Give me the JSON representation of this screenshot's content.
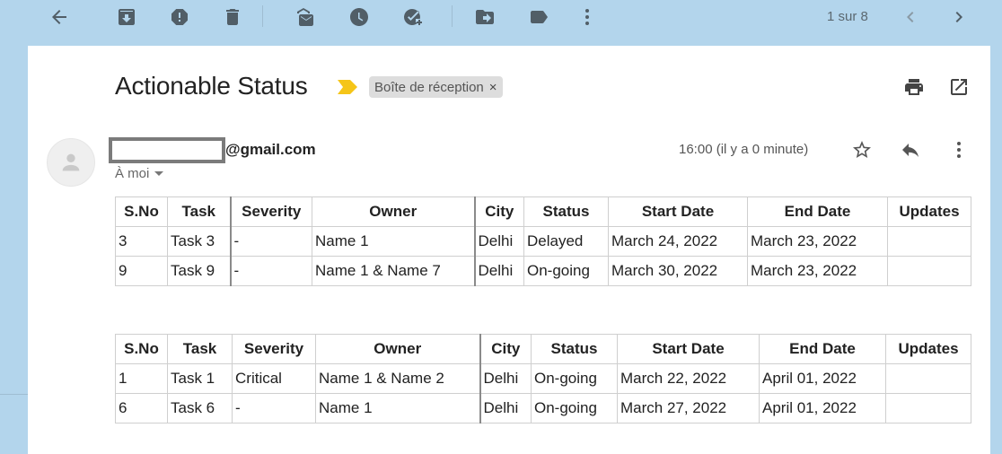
{
  "toolbar": {
    "icons": [
      "back-arrow-icon",
      "archive-icon",
      "report-spam-icon",
      "delete-icon",
      "mark-unread-icon",
      "snooze-icon",
      "add-to-tasks-icon",
      "move-to-icon",
      "labels-icon",
      "more-icon"
    ],
    "pager_text": "1 sur 8"
  },
  "email": {
    "subject": "Actionable Status",
    "label_chip": "Boîte de réception",
    "label_chip_remove": "×",
    "sender_domain": "@gmail.com",
    "recipient": "À moi",
    "timestamp": "16:00 (il y a 0 minute)"
  },
  "tables": [
    {
      "headers": [
        "S.No",
        "Task",
        "Severity",
        "Owner",
        "City",
        "Status",
        "Start Date",
        "End Date",
        "Updates"
      ],
      "rows": [
        [
          "3",
          "Task 3",
          "-",
          "Name 1",
          "Delhi",
          "Delayed",
          "March 24, 2022",
          "March 23, 2022",
          ""
        ],
        [
          "9",
          "Task 9",
          "-",
          "Name 1 & Name 7",
          "Delhi",
          "On-going",
          "March 30, 2022",
          "March 23, 2022",
          ""
        ]
      ]
    },
    {
      "headers": [
        "S.No",
        "Task",
        "Severity",
        "Owner",
        "City",
        "Status",
        "Start Date",
        "End Date",
        "Updates"
      ],
      "rows": [
        [
          "1",
          "Task 1",
          "Critical",
          "Name 1 & Name 2",
          "Delhi",
          "On-going",
          "March 22, 2022",
          "April 01, 2022",
          ""
        ],
        [
          "6",
          "Task 6",
          "-",
          "Name 1",
          "Delhi",
          "On-going",
          "March 27, 2022",
          "April 01, 2022",
          ""
        ]
      ]
    }
  ],
  "colors": {
    "background": "#b3d5ec",
    "icon": "#515e67",
    "importance_marker": "#f5c518",
    "chip_bg": "#dddddd"
  }
}
